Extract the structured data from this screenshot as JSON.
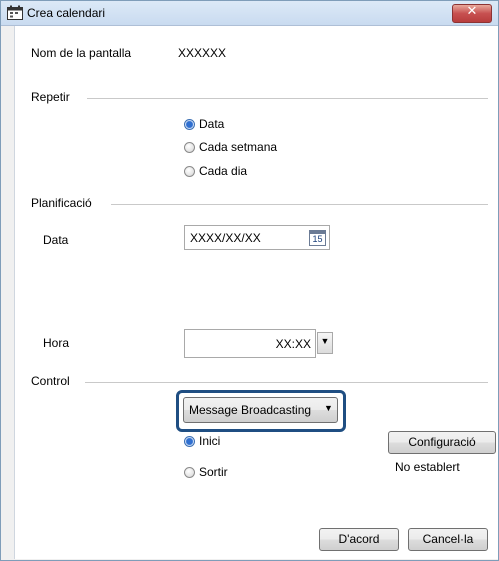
{
  "window": {
    "title": "Crea calendari",
    "close_symbol": "✕"
  },
  "screen": {
    "label": "Nom de la pantalla",
    "value": "XXXXXX"
  },
  "repeat": {
    "heading": "Repetir",
    "options": [
      {
        "label": "Data",
        "checked": true
      },
      {
        "label": "Cada setmana",
        "checked": false
      },
      {
        "label": "Cada dia",
        "checked": false
      }
    ]
  },
  "planning": {
    "heading": "Planificació",
    "date_label": "Data",
    "date_value": "XXXX/XX/XX",
    "calendar_day": "15",
    "time_label": "Hora",
    "time_value": "XX:XX",
    "dropdown_arrow": "▼"
  },
  "control": {
    "heading": "Control",
    "select_value": "Message Broadcasting",
    "dropdown_arrow": "▼",
    "options": [
      {
        "label": "Inici",
        "checked": true
      },
      {
        "label": "Sortir",
        "checked": false
      }
    ],
    "config_button": "Configuració",
    "config_status": "No establert"
  },
  "footer": {
    "ok_button": "D'acord",
    "cancel_button": "Cancel·la"
  },
  "colors": {
    "highlight": "#1f4e82",
    "radio_checked": "#2f6fd0"
  }
}
